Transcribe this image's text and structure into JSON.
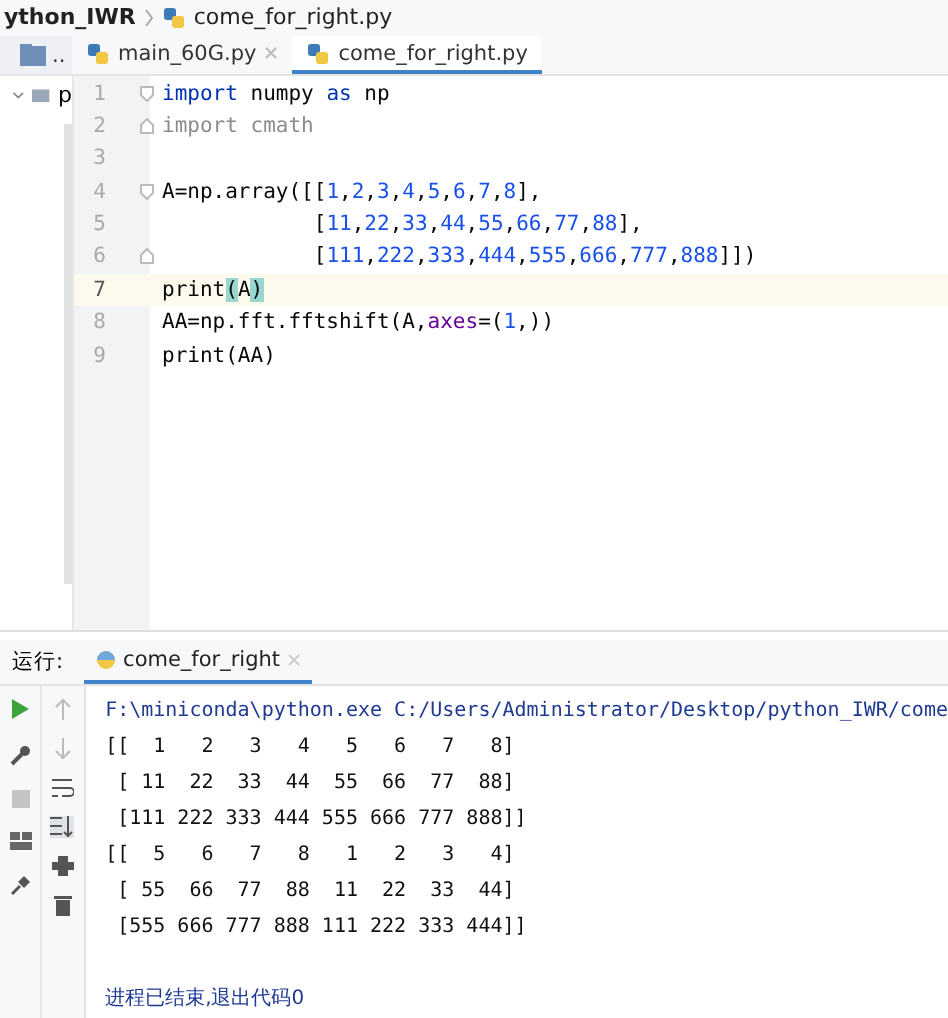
{
  "breadcrumb": {
    "project": "ython_IWR",
    "file": "come_for_right.py"
  },
  "project_tab": {
    "label": ".."
  },
  "editor_tabs": [
    {
      "label": "main_60G.py",
      "selected": false
    },
    {
      "label": "come_for_right.py",
      "selected": true
    }
  ],
  "project_tree": [
    {
      "label": "p",
      "expanded": true
    }
  ],
  "code_lines": [
    {
      "number": "1",
      "current": false,
      "fold_start": true,
      "tokens": [
        {
          "text": "import",
          "kind": "keyword"
        },
        {
          "text": " numpy ",
          "kind": "plain"
        },
        {
          "text": "as",
          "kind": "keyword"
        },
        {
          "text": " np",
          "kind": "plain"
        }
      ]
    },
    {
      "number": "2",
      "current": false,
      "fold_end": true,
      "tokens": [
        {
          "text": "import cmath",
          "kind": "unused"
        }
      ]
    },
    {
      "number": "3",
      "current": false
    },
    {
      "number": "4",
      "current": false,
      "fold_start": true,
      "tokens": [
        {
          "text": "A=np.array([[",
          "kind": "plain"
        },
        {
          "text": "1,2,3,4,5,6,7,8",
          "kind": "number_list"
        },
        {
          "text": "],",
          "kind": "plain"
        }
      ]
    },
    {
      "number": "5",
      "current": false,
      "tokens": [
        {
          "text": "            [",
          "kind": "plain"
        },
        {
          "text": "11,22,33,44,55,66,77,88",
          "kind": "number_list"
        },
        {
          "text": "],",
          "kind": "plain"
        }
      ]
    },
    {
      "number": "6",
      "current": false,
      "fold_end": true,
      "tokens": [
        {
          "text": "            [",
          "kind": "plain"
        },
        {
          "text": "111,222,333,444,555,666,777,888",
          "kind": "number_list"
        },
        {
          "text": "]])",
          "kind": "plain"
        }
      ]
    },
    {
      "number": "7",
      "current": true,
      "tokens": [
        {
          "text": "print",
          "kind": "plain"
        },
        {
          "text": "(",
          "kind": "brace_match"
        },
        {
          "text": "A",
          "kind": "plain"
        },
        {
          "text": ")",
          "kind": "brace_match"
        }
      ]
    },
    {
      "number": "8",
      "current": false,
      "tokens": [
        {
          "text": "AA=np.fft.fftshift(A,",
          "kind": "plain"
        },
        {
          "text": "axes",
          "kind": "param"
        },
        {
          "text": "=(",
          "kind": "plain"
        },
        {
          "text": "1",
          "kind": "number"
        },
        {
          "text": ",))",
          "kind": "plain"
        }
      ]
    },
    {
      "number": "9",
      "current": false,
      "tokens": [
        {
          "text": "print(AA)",
          "kind": "plain"
        }
      ]
    }
  ],
  "run_panel": {
    "title": "运行:",
    "tab": "come_for_right",
    "console": [
      {
        "text": "F:\\miniconda\\python.exe C:/Users/Administrator/Desktop/python_IWR/come",
        "kind": "command"
      },
      {
        "text": "[[  1   2   3   4   5   6   7   8]",
        "kind": "output"
      },
      {
        "text": " [ 11  22  33  44  55  66  77  88]",
        "kind": "output"
      },
      {
        "text": " [111 222 333 444 555 666 777 888]]",
        "kind": "output"
      },
      {
        "text": "[[  5   6   7   8   1   2   3   4]",
        "kind": "output"
      },
      {
        "text": " [ 55  66  77  88  11  22  33  44]",
        "kind": "output"
      },
      {
        "text": " [555 666 777 888 111 222 333 444]]",
        "kind": "output"
      },
      {
        "text": "进程已结束,退出代码0",
        "kind": "exit"
      }
    ]
  }
}
